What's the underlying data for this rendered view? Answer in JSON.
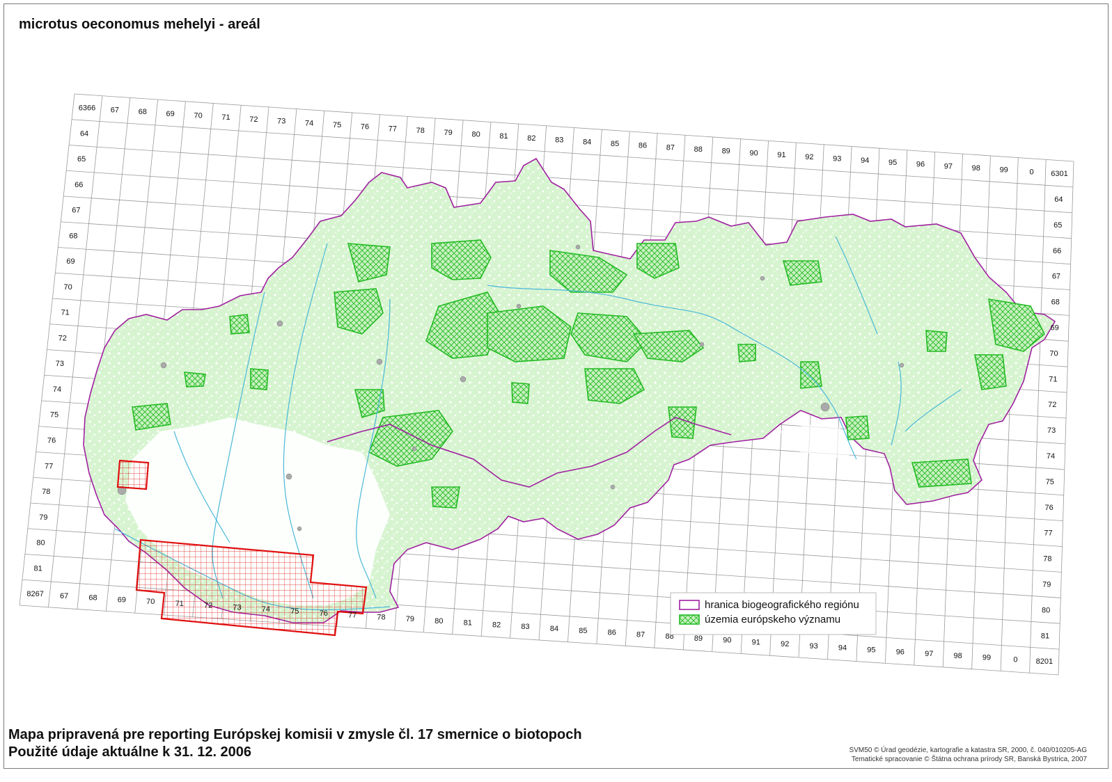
{
  "map": {
    "title": "microtus oeconomus mehelyi - areál",
    "grid": {
      "top_labels": [
        "6366",
        "67",
        "68",
        "69",
        "70",
        "71",
        "72",
        "73",
        "74",
        "75",
        "76",
        "77",
        "78",
        "79",
        "80",
        "81",
        "82",
        "83",
        "84",
        "85",
        "86",
        "87",
        "88",
        "89",
        "90",
        "91",
        "92",
        "93",
        "94",
        "95",
        "96",
        "97",
        "98",
        "99",
        "0",
        "6301"
      ],
      "bottom_labels": [
        "8267",
        "67",
        "68",
        "69",
        "70",
        "71",
        "72",
        "73",
        "74",
        "75",
        "76",
        "77",
        "78",
        "79",
        "80",
        "81",
        "82",
        "83",
        "84",
        "85",
        "86",
        "87",
        "88",
        "89",
        "90",
        "91",
        "92",
        "93",
        "94",
        "95",
        "96",
        "97",
        "98",
        "99",
        "0",
        "8201"
      ],
      "left_labels": [
        "64",
        "65",
        "66",
        "67",
        "68",
        "69",
        "70",
        "71",
        "72",
        "73",
        "74",
        "75",
        "76",
        "77",
        "78",
        "79",
        "80",
        "81"
      ],
      "right_labels": [
        "64",
        "65",
        "66",
        "67",
        "68",
        "69",
        "70",
        "71",
        "72",
        "73",
        "74",
        "75",
        "76",
        "77",
        "78",
        "79",
        "80",
        "81"
      ]
    },
    "legend": {
      "items": [
        {
          "label": "hranica biogeografického regiónu",
          "symbol": "boundary",
          "color": "#a020a0"
        },
        {
          "label": "územia európskeho významu",
          "symbol": "hatch",
          "color": "#22bb22"
        }
      ]
    },
    "colors": {
      "grid": "#9a9a9a",
      "boundary": "#a020a0",
      "territory_fill": "#c8f0c0",
      "sites": "#22bb22",
      "rivers": "#4ab8d8",
      "range": "#e01010",
      "towns": "#aaaaaa"
    }
  },
  "footer": {
    "line1": "Mapa pripravená pre reporting Európskej komisii v zmysle čl. 17 smernice o biotopoch",
    "line2": "Použité údaje aktuálne k 31. 12. 2006"
  },
  "credits": {
    "line1": "SVM50 © Úrad geodézie, kartografie a katastra SR, 2000, č. 040/010205-AG",
    "line2": "Tematické spracovanie © Štátna ochrana prírody SR, Banská Bystrica, 2007"
  }
}
